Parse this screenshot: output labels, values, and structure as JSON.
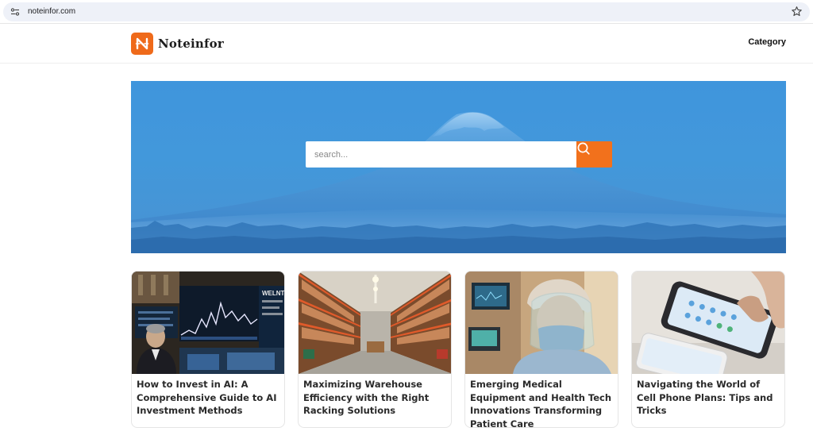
{
  "browser": {
    "url": "noteinfor.com"
  },
  "header": {
    "logo_text": "Noteinfor",
    "nav_category": "Category"
  },
  "hero": {
    "search_placeholder": "search..."
  },
  "articles": [
    {
      "title": "How to Invest in AI: A Comprehensive Guide to AI Investment Methods",
      "image_icon": "stock-market-photo",
      "screen_text": "WELNT"
    },
    {
      "title": "Maximizing Warehouse Efficiency with the Right Racking Solutions",
      "image_icon": "warehouse-photo"
    },
    {
      "title": "Emerging Medical Equipment and Health Tech Innovations Transforming Patient Care",
      "image_icon": "medical-worker-photo"
    },
    {
      "title": "Navigating the World of Cell Phone Plans: Tips and Tricks",
      "image_icon": "smartphone-photo"
    }
  ],
  "colors": {
    "accent": "#f2711c",
    "hero_blue": "#4399db"
  }
}
